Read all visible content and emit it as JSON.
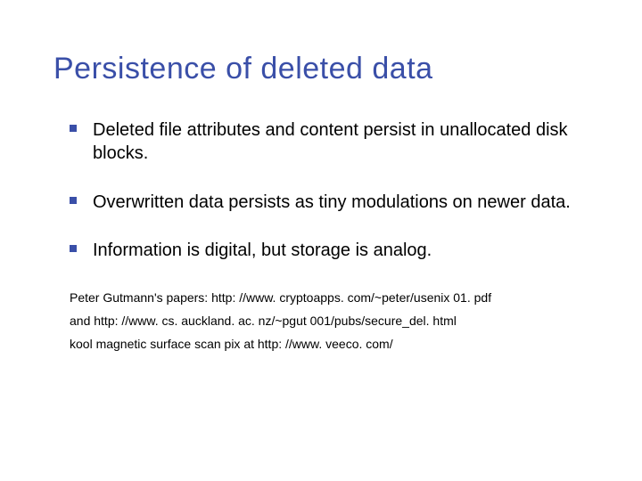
{
  "title": "Persistence of deleted data",
  "bullets": [
    "Deleted file attributes and content persist in unallocated disk blocks.",
    "Overwritten data persists as tiny modulations on newer data.",
    "Information is digital, but storage is analog."
  ],
  "refs": [
    "Peter Gutmann's papers: http: //www. cryptoapps. com/~peter/usenix 01. pdf",
    "and http: //www. cs. auckland. ac. nz/~pgut 001/pubs/secure_del. html",
    "kool magnetic surface scan pix at http: //www. veeco. com/"
  ]
}
